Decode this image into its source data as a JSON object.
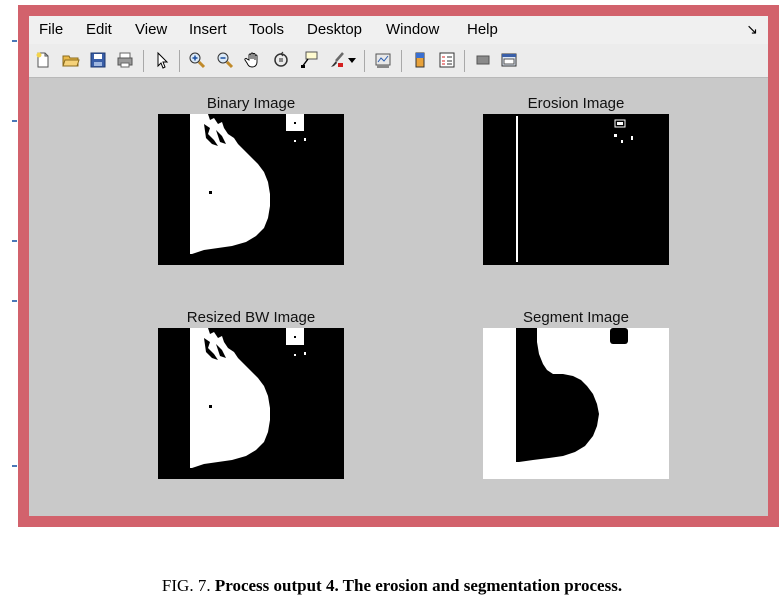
{
  "menu": {
    "items": [
      "File",
      "Edit",
      "View",
      "Insert",
      "Tools",
      "Desktop",
      "Window",
      "Help"
    ],
    "dock_icon": "dock-arrow-icon"
  },
  "toolbar": {
    "buttons": [
      "new-figure-icon",
      "open-file-icon",
      "save-icon",
      "print-icon",
      "pointer-icon",
      "zoom-in-icon",
      "zoom-out-icon",
      "pan-hand-icon",
      "rotate-3d-icon",
      "data-cursor-icon",
      "brush-icon",
      "dropdown-arrow-icon",
      "link-plot-icon",
      "colorbar-icon",
      "legend-icon",
      "hide-plot-tools-icon",
      "show-plot-tools-icon"
    ]
  },
  "plots": {
    "binary": {
      "title": "Binary Image"
    },
    "erosion": {
      "title": "Erosion Image"
    },
    "resized": {
      "title": "Resized BW Image"
    },
    "segment": {
      "title": "Segment Image"
    }
  },
  "caption": {
    "prefix": "FIG. 7.",
    "text": "Process output 4. The erosion and segmentation process."
  },
  "colors": {
    "window_border": "#d2626c",
    "figure_background": "#c9c9c9",
    "image_black": "#000000",
    "image_white": "#ffffff"
  }
}
